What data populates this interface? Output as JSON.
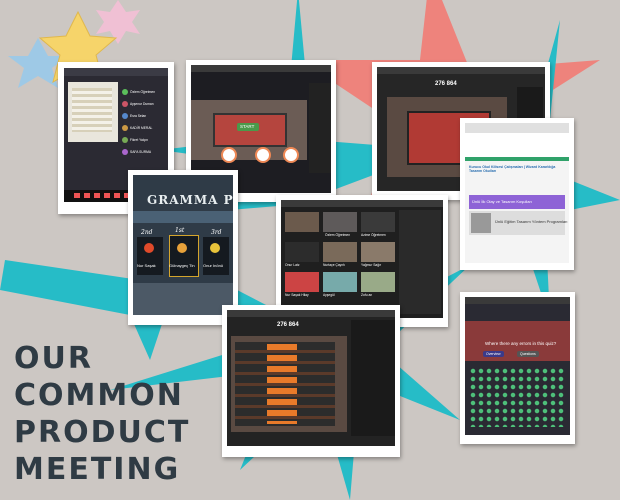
{
  "title_lines": [
    "OUR",
    "COMMON",
    "PRODUCT",
    "MEETING"
  ],
  "colors": {
    "background": "#ccc7c3",
    "teal_star": "#26bcc7",
    "coral_star": "#ef8078",
    "title_text": "#2f3b44",
    "yellow_star": "#f6d46a",
    "blue_star": "#9ec9e6",
    "pink_star": "#f0c0d4"
  },
  "icons": [
    "yellow-star-icon",
    "blue-star-icon",
    "pink-star-icon",
    "teal-burst-star-icon",
    "coral-star-icon"
  ],
  "screenshots": {
    "s1": {
      "tile_names": [
        "Özlem Öğretmen",
        "Ayşenur Duman",
        "Esra Selan",
        "KADİR MERAL",
        "Fikret Yalçın",
        "SAFA SURMA"
      ]
    },
    "s2": {
      "start_label": "START"
    },
    "s3": {
      "game_code": "276 864"
    },
    "s4": {
      "page_title": "Kurucu Okul Kilisesi Çalışmaları | Wizard Kararlılığa Tasarım Okulları",
      "card_1": "Ünlü İlk Olay ve Tasarım Koşulları",
      "card_2": "Ünlü Eğitim Tasarım Yöntem Programları"
    },
    "s5": {
      "banner": "GRAMMA PHO",
      "ranks": [
        "2nd",
        "1st",
        "3rd"
      ],
      "names": [
        "Nur Saşak",
        "Gülnaygeç Tin",
        "Onur Inönü"
      ]
    },
    "s6": {
      "tiles": [
        "Özlem Öğretmen",
        "Azime Öğretmen",
        "Onur Latz",
        "Nurtaçe Çayırlı",
        "Yağmur Sağır",
        "Nur Saşak Hilay",
        "Ayşegül",
        "Zofu an"
      ]
    },
    "s7": {
      "game_code": "276 864"
    },
    "s8": {
      "question": "Where there any errors in this quiz?",
      "overview_label": "Overview",
      "questions_label": "Questions"
    }
  }
}
